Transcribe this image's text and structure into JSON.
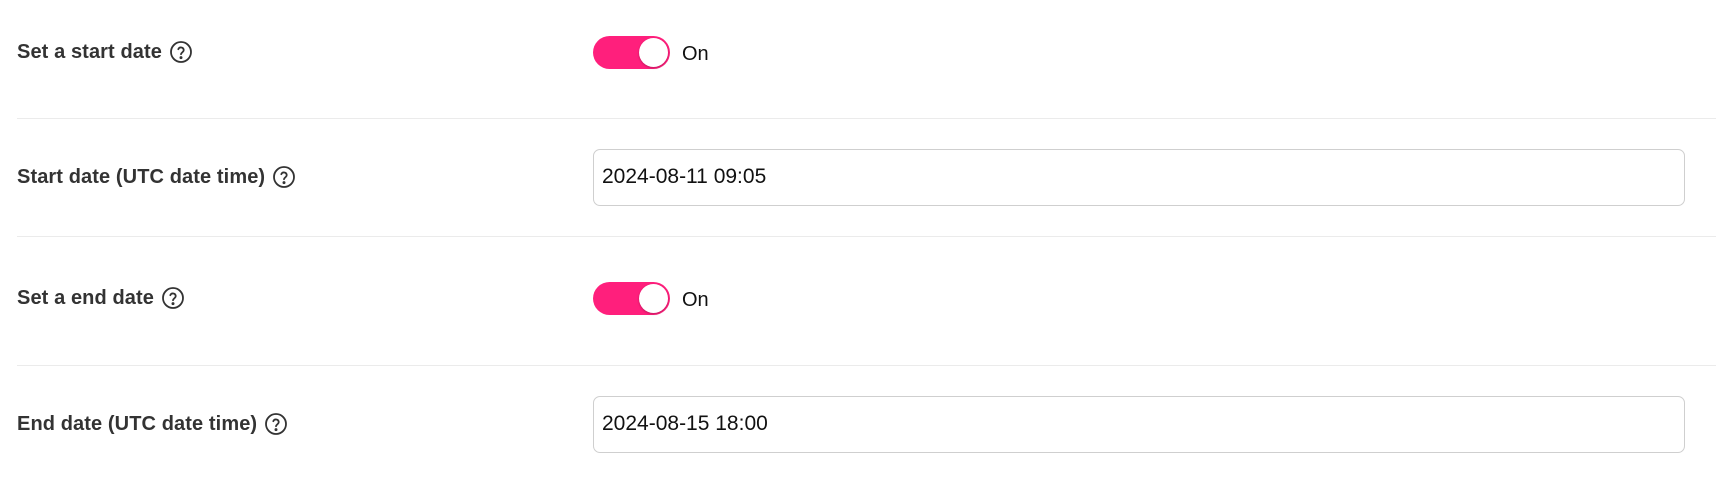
{
  "settings": {
    "start_toggle": {
      "label": "Set a start date",
      "state_text": "On",
      "checked": true
    },
    "start_date": {
      "label": "Start date (UTC date time)",
      "value": "2024-08-11 09:05"
    },
    "end_toggle": {
      "label": "Set a end date",
      "state_text": "On",
      "checked": true
    },
    "end_date": {
      "label": "End date (UTC date time)",
      "value": "2024-08-15 18:00"
    }
  },
  "colors": {
    "toggle_on": "#ff1f7c",
    "label_text": "#333333",
    "input_border": "#cfcfcf",
    "divider": "#ebebeb"
  },
  "icons": {
    "help": "question-circle-icon"
  }
}
